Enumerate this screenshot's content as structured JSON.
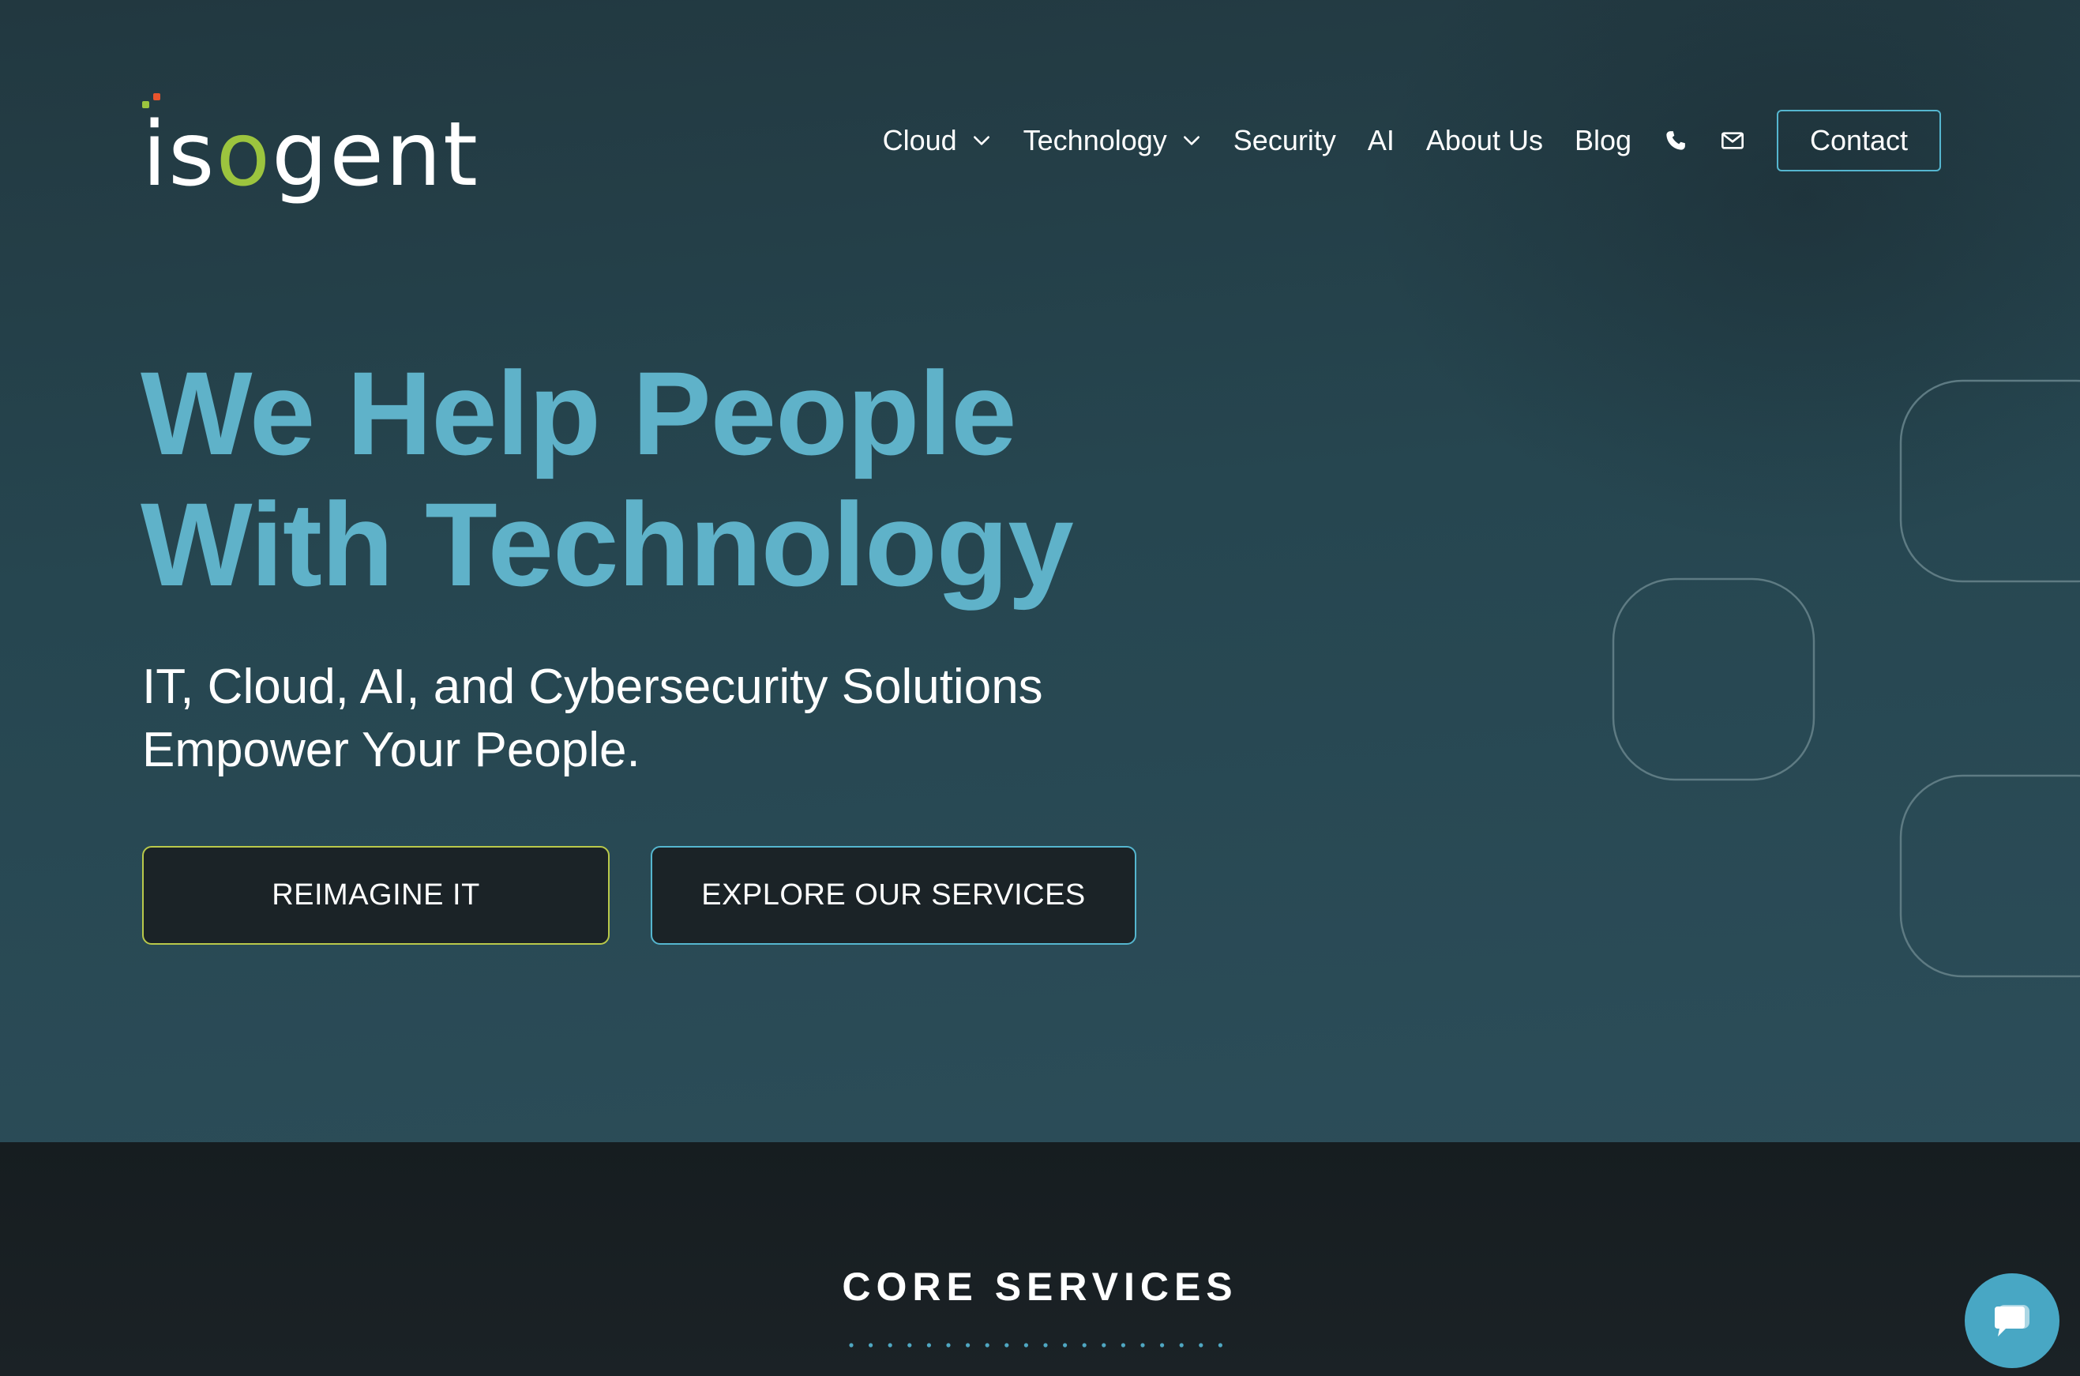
{
  "header": {
    "logo": {
      "pre": "is",
      "accent": "o",
      "post": "gent",
      "dot_colors": [
        "#e8542d",
        "#9cc43e"
      ]
    },
    "nav": [
      {
        "label": "Cloud",
        "has_dropdown": true
      },
      {
        "label": "Technology",
        "has_dropdown": true
      },
      {
        "label": "Security",
        "has_dropdown": false
      },
      {
        "label": "AI",
        "has_dropdown": false
      },
      {
        "label": "About Us",
        "has_dropdown": false
      },
      {
        "label": "Blog",
        "has_dropdown": false
      }
    ],
    "icons": [
      "phone-icon",
      "mail-icon"
    ],
    "contact_label": "Contact"
  },
  "hero": {
    "headline_line1": "We Help People",
    "headline_line2": "With Technology",
    "subtitle_line1": "IT, Cloud, AI, and Cybersecurity Solutions",
    "subtitle_line2": "Empower Your People.",
    "primary_button": "REIMAGINE IT",
    "secondary_button": "EXPLORE OUR SERVICES"
  },
  "core_services": {
    "title": "CORE SERVICES"
  },
  "chat": {
    "icon": "chat-bubble-icon"
  },
  "colors": {
    "accent_teal": "#5fb2c9",
    "accent_green": "#9cc43e",
    "button_border_yellow": "#b9c94a",
    "button_border_teal": "#55b6cf",
    "chat_button": "#48a7c4"
  }
}
